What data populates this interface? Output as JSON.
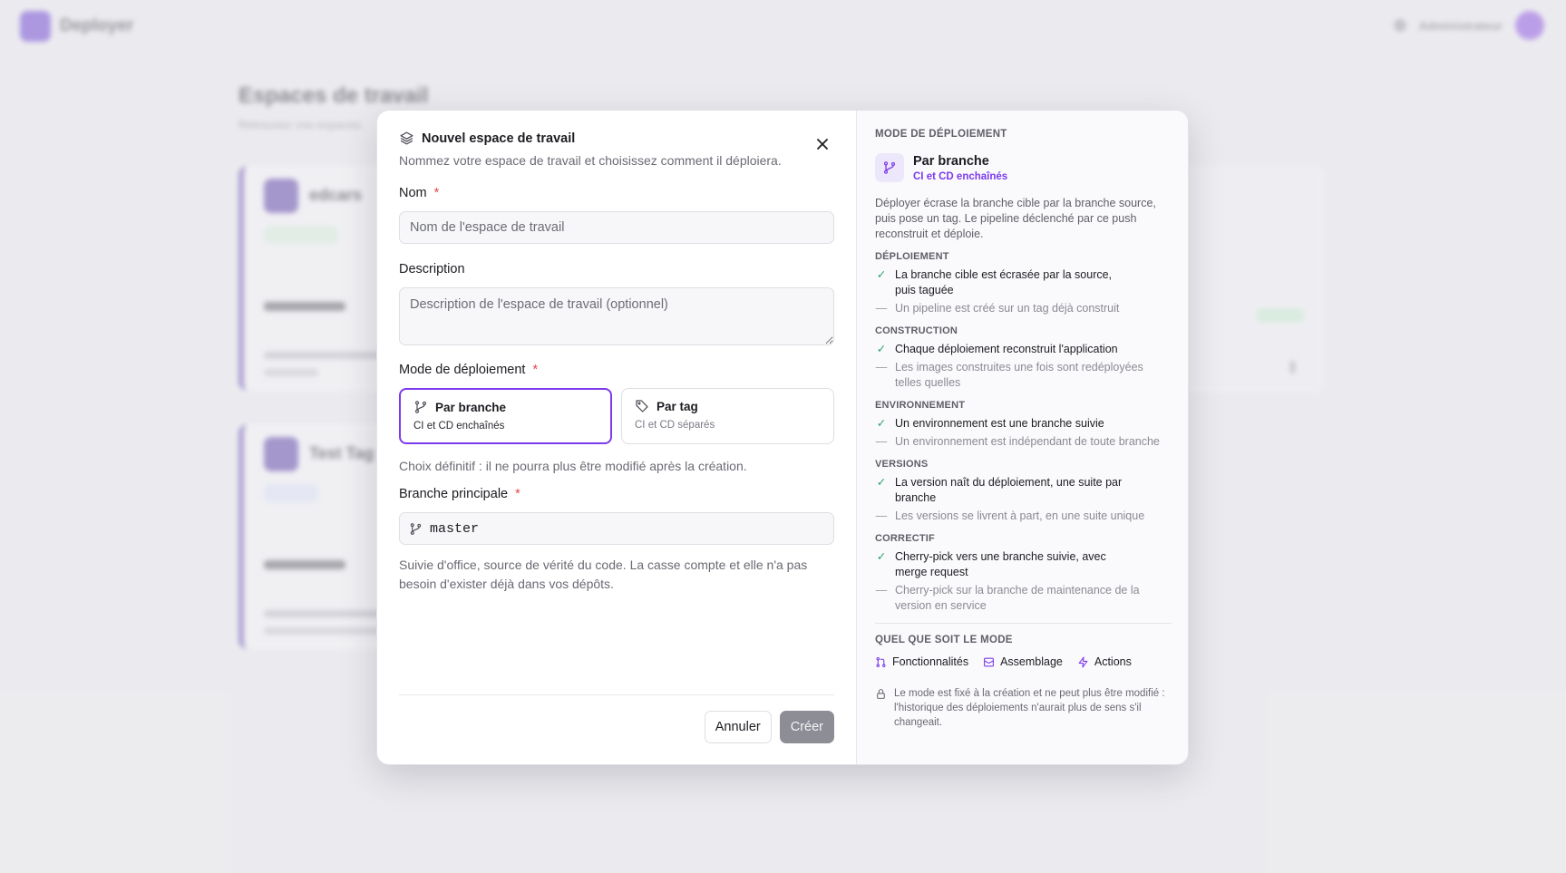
{
  "background": {
    "brand": "Deployer",
    "user_name": "Administrateur",
    "page_title": "Espaces de travail",
    "page_subtitle": "Retrouvez vos espaces",
    "cards": [
      {
        "name": "edcars"
      },
      {
        "name": "Test Tag"
      }
    ]
  },
  "modal": {
    "title": "Nouvel espace de travail",
    "description": "Nommez votre espace de travail et choisissez comment il déploiera.",
    "name": {
      "label": "Nom",
      "required_mark": "*",
      "placeholder": "Nom de l'espace de travail",
      "value": ""
    },
    "desc_field": {
      "label": "Description",
      "placeholder": "Description de l'espace de travail (optionnel)",
      "value": ""
    },
    "mode": {
      "label": "Mode de déploiement",
      "required_mark": "*",
      "options": [
        {
          "name": "Par branche",
          "sub": "CI et CD enchaînés",
          "selected": true,
          "icon": "git-branch-icon"
        },
        {
          "name": "Par tag",
          "sub": "CI et CD séparés",
          "selected": false,
          "icon": "tag-icon"
        }
      ],
      "hint": "Choix définitif : il ne pourra plus être modifié après la création."
    },
    "branch": {
      "label": "Branche principale",
      "required_mark": "*",
      "value": "master",
      "hint": "Suivie d'office, source de vérité du code. La casse compte et elle n'a pas besoin d'exister déjà dans vos dépôts."
    },
    "buttons": {
      "cancel": "Annuler",
      "create": "Créer"
    }
  },
  "info": {
    "caption": "MODE DE DÉPLOIEMENT",
    "mode_title": "Par branche",
    "mode_sub": "CI et CD enchaînés",
    "description": "Déployer écrase la branche cible par la branche source, puis pose un tag. Le pipeline déclenché par ce push reconstruit et déploie.",
    "groups": [
      {
        "title": "DÉPLOIEMENT",
        "yes": "La branche cible est écrasée par la source, puis taguée",
        "no": "Un pipeline est créé sur un tag déjà construit"
      },
      {
        "title": "CONSTRUCTION",
        "yes": "Chaque déploiement reconstruit l'application",
        "no": "Les images construites une fois sont redéployées telles quelles"
      },
      {
        "title": "ENVIRONNEMENT",
        "yes": "Un environnement est une branche suivie",
        "no": "Un environnement est indépendant de toute branche"
      },
      {
        "title": "VERSIONS",
        "yes": "La version naît du déploiement, une suite par branche",
        "no": "Les versions se livrent à part, en une suite unique"
      },
      {
        "title": "CORRECTIF",
        "yes": "Cherry-pick vers une branche suivie, avec merge request",
        "no": "Cherry-pick sur la branche de maintenance de la version en service"
      }
    ],
    "always_caption": "QUEL QUE SOIT LE MODE",
    "always": [
      {
        "label": "Fonctionnalités",
        "icon": "git-pull-request-icon"
      },
      {
        "label": "Assemblage",
        "icon": "assembly-icon"
      },
      {
        "label": "Actions",
        "icon": "lightning-icon"
      }
    ],
    "lock_note": "Le mode est fixé à la création et ne peut plus être modifié : l'historique des déploiements n'aurait plus de sens s'il changeait."
  },
  "colors": {
    "accent": "#7c3aed",
    "success": "#30a46c",
    "required": "#e5484d"
  }
}
